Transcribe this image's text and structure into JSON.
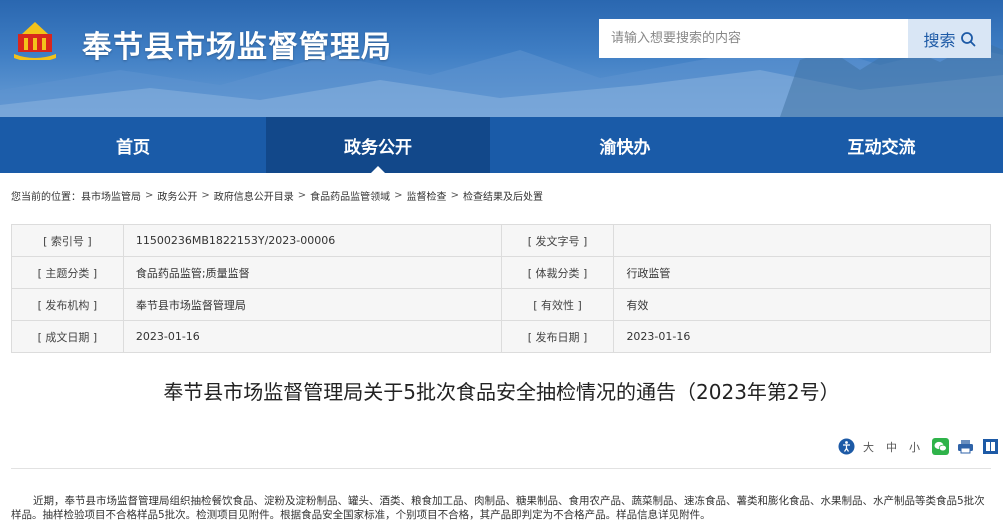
{
  "header": {
    "site_title": "奉节县市场监督管理局",
    "search_placeholder": "请输入想要搜索的内容",
    "search_button": "搜索"
  },
  "nav": {
    "items": [
      {
        "label": "首页",
        "active": false
      },
      {
        "label": "政务公开",
        "active": true
      },
      {
        "label": "渝快办",
        "active": false
      },
      {
        "label": "互动交流",
        "active": false
      }
    ]
  },
  "breadcrumb": {
    "prefix": "您当前的位置：",
    "items": [
      "县市场监管局",
      "政务公开",
      "政府信息公开目录",
      "食品药品监管领域",
      "监督检查",
      "检查结果及后处置"
    ]
  },
  "info_table": {
    "rows": [
      {
        "label1": "[ 索引号 ]",
        "value1": "11500236MB1822153Y/2023-00006",
        "label2": "[ 发文字号 ]",
        "value2": ""
      },
      {
        "label1": "[ 主题分类 ]",
        "value1": "食品药品监管;质量监督",
        "label2": "[ 体裁分类 ]",
        "value2": "行政监管"
      },
      {
        "label1": "[ 发布机构 ]",
        "value1": "奉节县市场监督管理局",
        "label2": "[ 有效性 ]",
        "value2": "有效"
      },
      {
        "label1": "[ 成文日期 ]",
        "value1": "2023-01-16",
        "label2": "[ 发布日期 ]",
        "value2": "2023-01-16"
      }
    ]
  },
  "document": {
    "title": "奉节县市场监督管理局关于5批次食品安全抽检情况的通告（2023年第2号）",
    "body": "近期，奉节县市场监督管理局组织抽检餐饮食品、淀粉及淀粉制品、罐头、酒类、粮食加工品、肉制品、糖果制品、食用农产品、蔬菜制品、速冻食品、薯类和膨化食品、水果制品、水产制品等类食品5批次样品。抽样检验项目不合格样品5批次。检测项目见附件。根据食品安全国家标准，个别项目不合格，其产品即判定为不合格产品。样品信息详见附件。"
  },
  "tools": {
    "font_large": "大",
    "font_medium": "中",
    "font_small": "小"
  },
  "colors": {
    "nav_bg": "#1a5ba8",
    "nav_active": "#12488a",
    "header_bg": "#2a67b0"
  }
}
